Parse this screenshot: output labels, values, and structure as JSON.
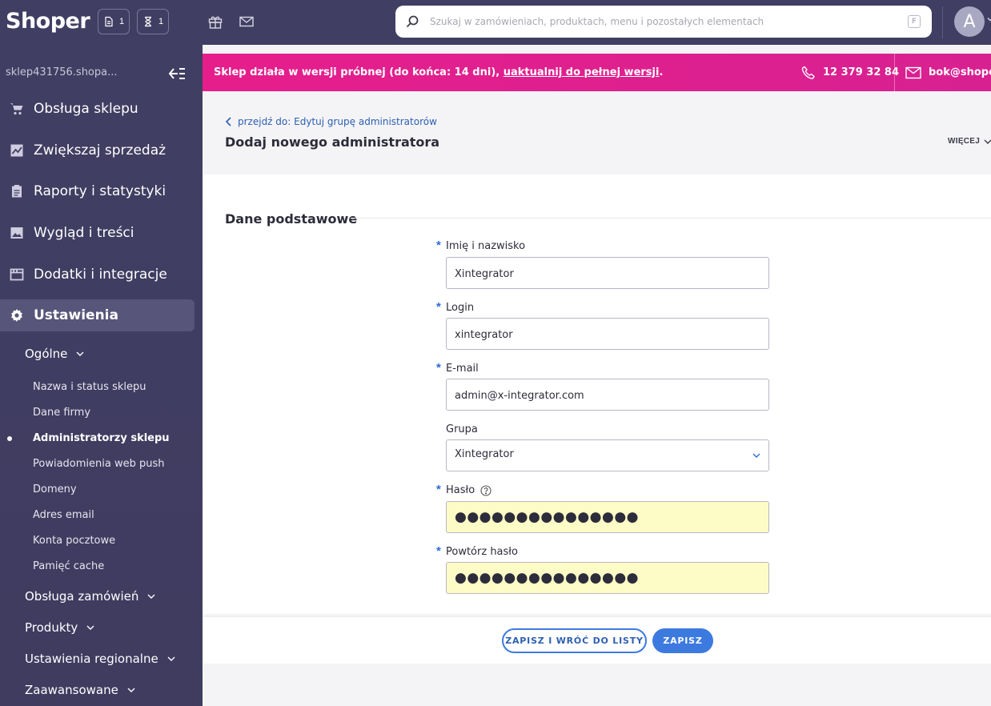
{
  "topbar": {
    "logo": "Shoper",
    "counter_docs": "1",
    "counter_tasks": "1",
    "search_placeholder": "Szukaj w zamówieniach, produktach, menu i pozostałych elementach",
    "search_shortcut": "F",
    "avatar_initial": "A"
  },
  "sidebar": {
    "shop_domain": "sklep431756.shopa...",
    "nav": [
      {
        "label": "Obsługa sklepu",
        "icon": "cart-icon"
      },
      {
        "label": "Zwiększaj sprzedaż",
        "icon": "chart-icon"
      },
      {
        "label": "Raporty i statystyki",
        "icon": "clipboard-icon"
      },
      {
        "label": "Wygląd i treści",
        "icon": "image-icon"
      },
      {
        "label": "Dodatki i integracje",
        "icon": "window-icon"
      },
      {
        "label": "Ustawienia",
        "icon": "gear-icon"
      }
    ],
    "groups": {
      "general": "Ogólne",
      "orders": "Obsługa zamówień",
      "products": "Produkty",
      "regional": "Ustawienia regionalne",
      "advanced": "Zaawansowane"
    },
    "sub_items": [
      "Nazwa i status sklepu",
      "Dane firmy",
      "Administratorzy sklepu",
      "Powiadomienia web push",
      "Domeny",
      "Adres email",
      "Konta pocztowe",
      "Pamięć cache"
    ]
  },
  "banner": {
    "text": "Sklep działa w wersji próbnej (do końca: 14 dni), ",
    "link": "uaktualnij do pełnej wersji",
    "suffix": ".",
    "phone": "12 379 32 84",
    "email": "bok@shoper.pl"
  },
  "header": {
    "back_link": "przejdź do: Edytuj grupę administratorów",
    "title": "Dodaj nowego administratora",
    "more": "WIĘCEJ"
  },
  "form": {
    "section_title": "Dane podstawowe",
    "name_label": "Imię i nazwisko",
    "name_value": "Xintegrator",
    "login_label": "Login",
    "login_value": "xintegrator",
    "email_label": "E-mail",
    "email_value": "admin@x-integrator.com",
    "group_label": "Grupa",
    "group_value": "Xintegrator",
    "password_label": "Hasło",
    "password_value": "●●●●●●●●●●●●●●●",
    "password_repeat_label": "Powtórz hasło",
    "password_repeat_value": "●●●●●●●●●●●●●●●",
    "required_mark": "*"
  },
  "footer": {
    "save_and_back": "ZAPISZ I WRÓĆ DO LISTY",
    "save": "ZAPISZ"
  },
  "colors": {
    "sidebar_bg": "#413e63",
    "banner_bg": "#e61e8c",
    "accent": "#3d7ae0",
    "password_bg": "#fdfbc6"
  }
}
